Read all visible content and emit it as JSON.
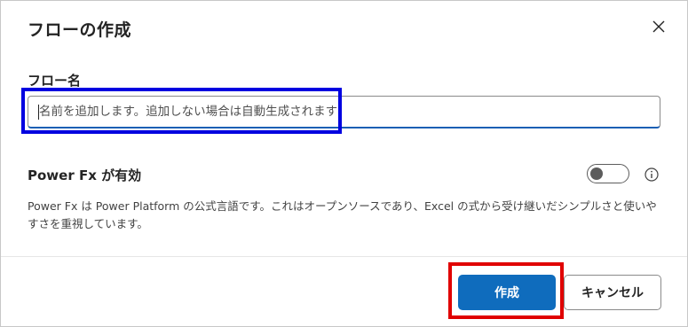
{
  "dialog": {
    "title": "フローの作成",
    "close_icon": "close-icon"
  },
  "flow_name": {
    "label": "フロー名",
    "value": "",
    "placeholder": "名前を追加します。追加しない場合は自動生成されます"
  },
  "power_fx": {
    "label": "Power Fx が有効",
    "toggle_on": false,
    "info_icon": "info-icon",
    "description": "Power Fx は Power Platform の公式言語です。これはオープンソースであり、Excel の式から受け継いだシンプルさと使いやすさを重視しています。"
  },
  "footer": {
    "create_label": "作成",
    "cancel_label": "キャンセル"
  },
  "colors": {
    "primary": "#0f6cbd",
    "annotation_blue": "#0000e0",
    "annotation_red": "#e00000"
  }
}
